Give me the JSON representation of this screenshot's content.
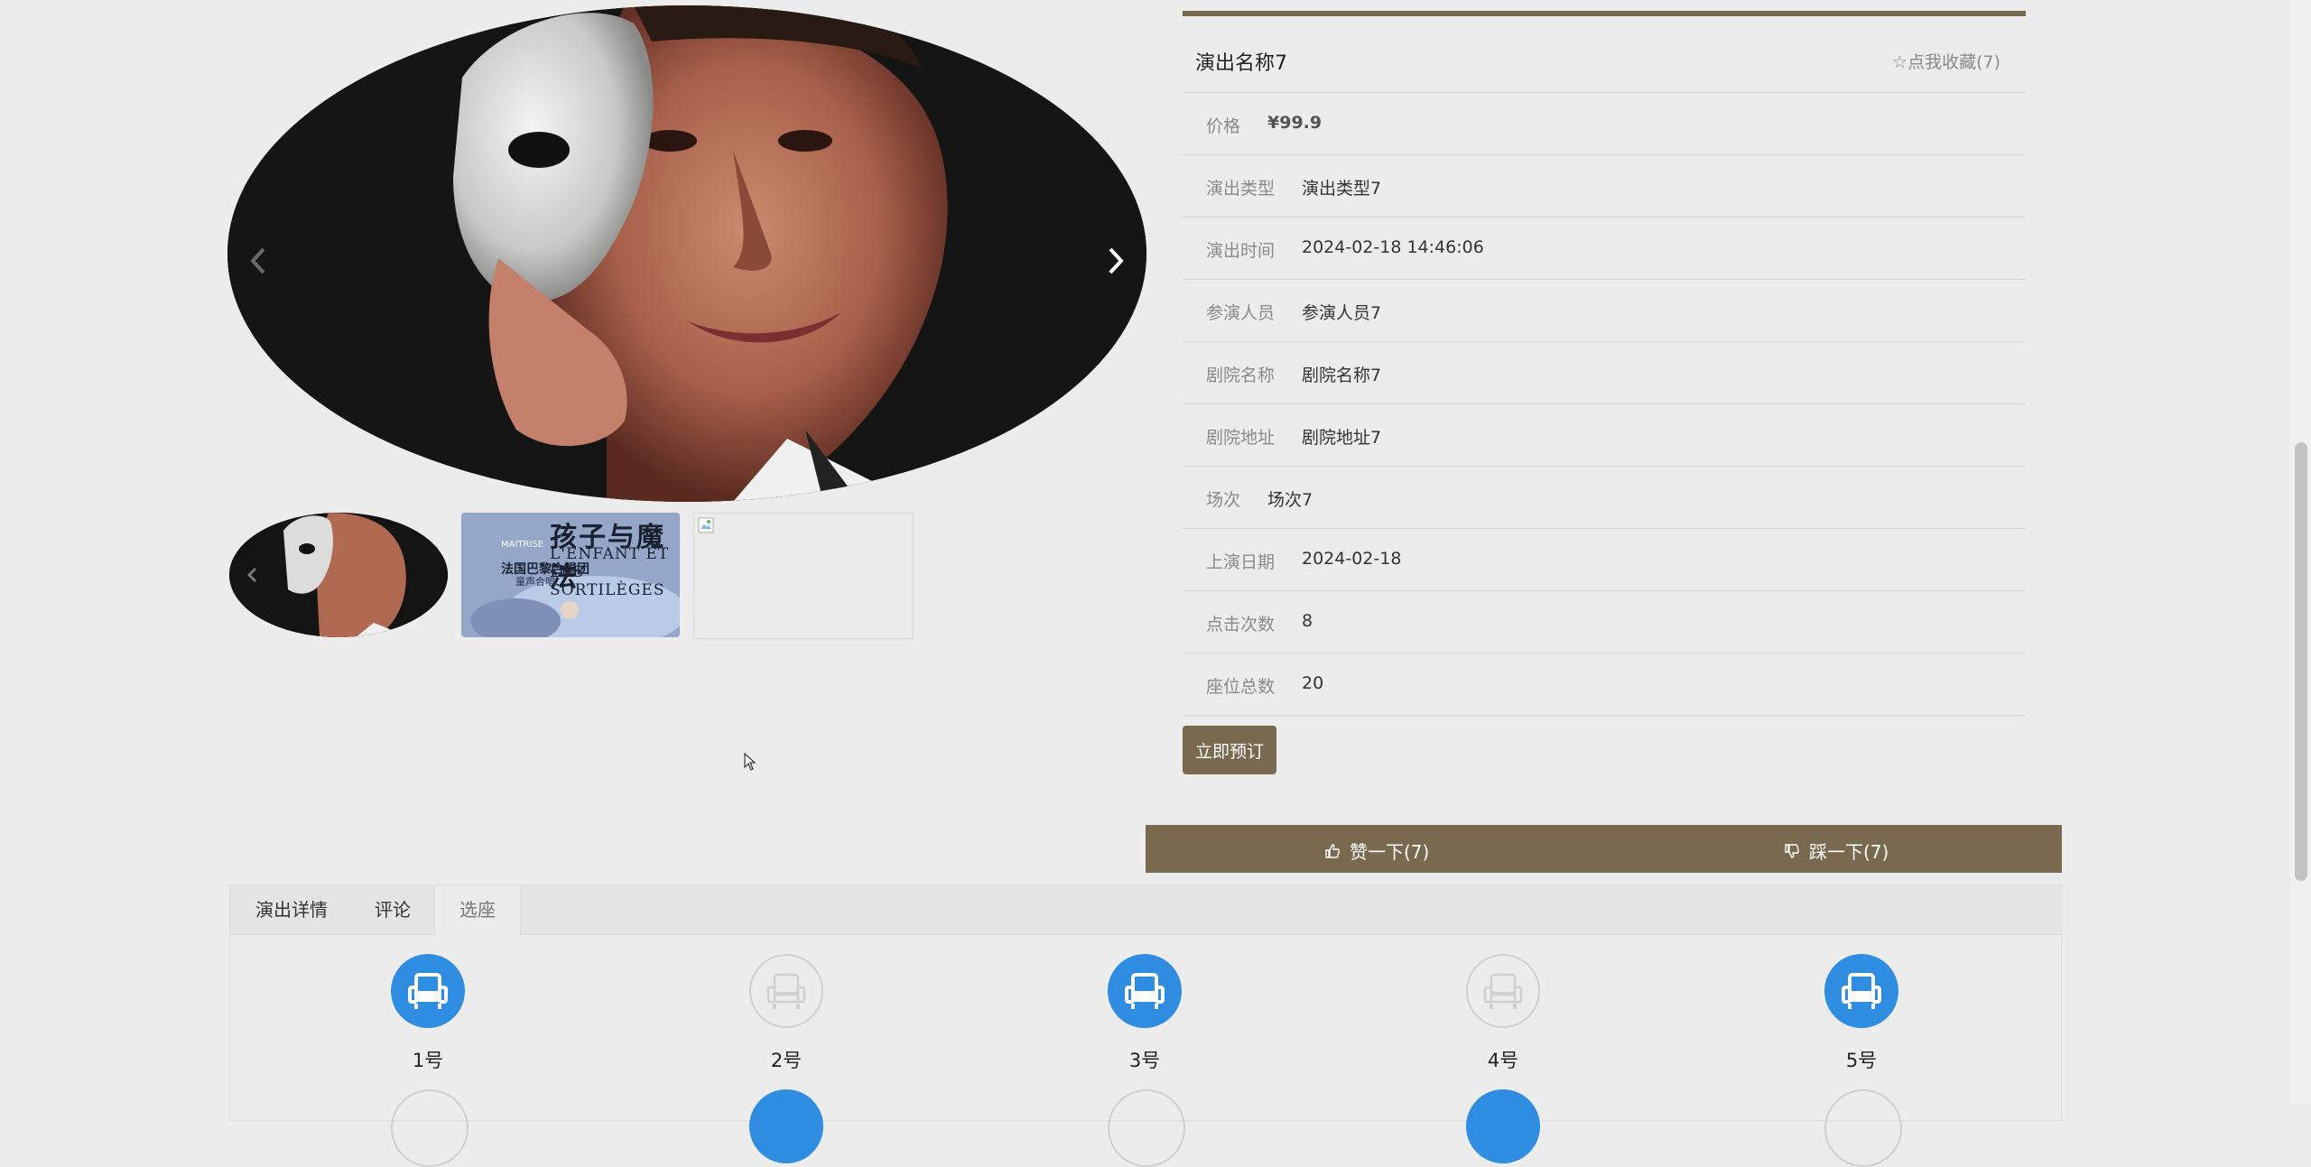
{
  "gallery": {
    "thumb_2": {
      "title": "孩子与魔法",
      "line_1": "MAITRISE",
      "line_2": "L'ENFANT ET LES SORTILÈGES",
      "line_3": "法国巴黎合唱团",
      "line_4": "童声合唱"
    }
  },
  "info": {
    "title": "演出名称7",
    "favorite": {
      "icon": "star-outline-icon",
      "label": "点我收藏(7)"
    },
    "rows": [
      {
        "label": "价格",
        "value": "¥99.9"
      },
      {
        "label": "演出类型",
        "value": "演出类型7"
      },
      {
        "label": "演出时间",
        "value": "2024-02-18 14:46:06"
      },
      {
        "label": "参演人员",
        "value": "参演人员7"
      },
      {
        "label": "剧院名称",
        "value": "剧院名称7"
      },
      {
        "label": "剧院地址",
        "value": "剧院地址7"
      },
      {
        "label": "场次",
        "value": "场次7"
      },
      {
        "label": "上演日期",
        "value": "2024-02-18"
      },
      {
        "label": "点击次数",
        "value": "8"
      },
      {
        "label": "座位总数",
        "value": "20"
      }
    ],
    "book_label": "立即预订"
  },
  "votes": {
    "up_label": "赞一下(7)",
    "down_label": "踩一下(7)"
  },
  "tabs": [
    {
      "label": "演出详情"
    },
    {
      "label": "评论"
    },
    {
      "label": "选座",
      "active": true
    }
  ],
  "seats": [
    {
      "label": "1号",
      "taken": true
    },
    {
      "label": "2号",
      "taken": false
    },
    {
      "label": "3号",
      "taken": true
    },
    {
      "label": "4号",
      "taken": false
    },
    {
      "label": "5号",
      "taken": true
    }
  ],
  "colors": {
    "accent": "#78694f",
    "seat_taken": "#2e8de0",
    "seat_free_border": "#cfcfcf",
    "page_bg": "#ececec"
  }
}
